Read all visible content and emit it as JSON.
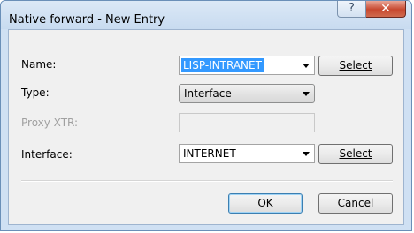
{
  "window": {
    "title": "Native forward - New Entry",
    "help_glyph": "?",
    "close_glyph": "✕"
  },
  "form": {
    "name": {
      "label": "Name:",
      "value": "LISP-INTRANET",
      "select_button": "Select"
    },
    "type": {
      "label": "Type:",
      "value": "Interface"
    },
    "proxy_xtr": {
      "label": "Proxy XTR:",
      "value": ""
    },
    "interface": {
      "label": "Interface:",
      "value": "INTERNET",
      "select_button": "Select"
    }
  },
  "buttons": {
    "ok": "OK",
    "cancel": "Cancel"
  }
}
